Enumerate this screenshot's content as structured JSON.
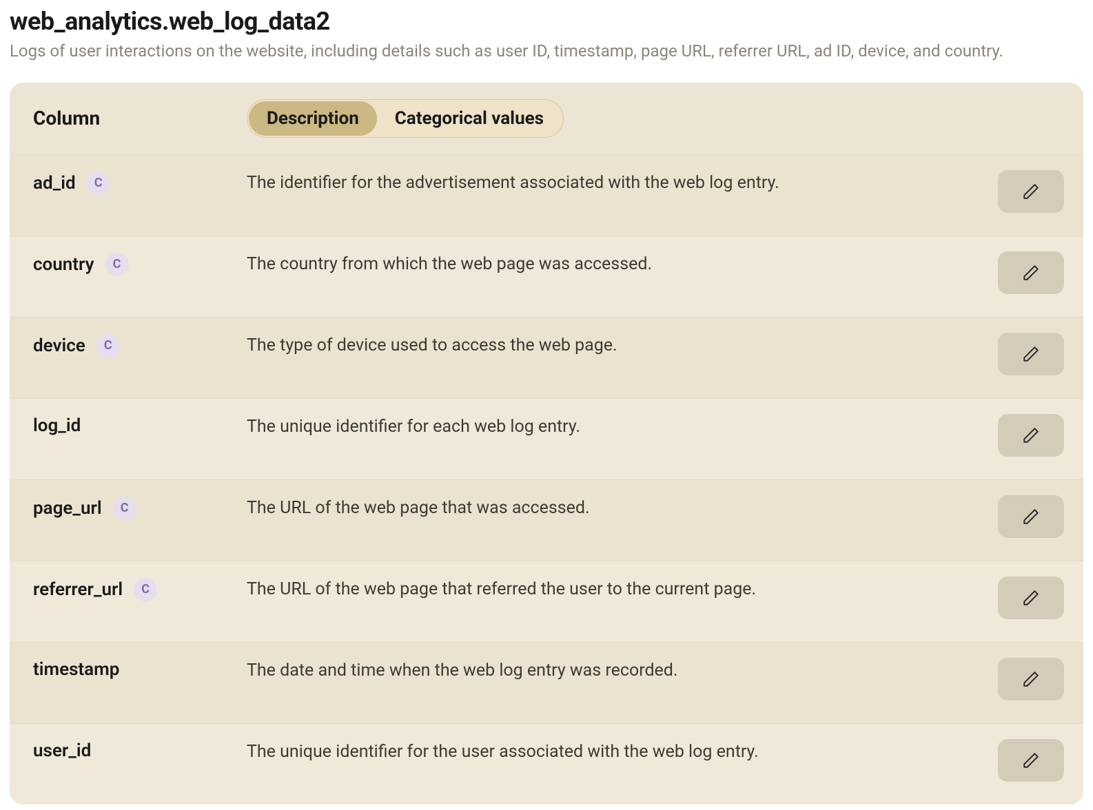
{
  "header": {
    "title": "web_analytics.web_log_data2",
    "subtitle": "Logs of user interactions on the website, including details such as user ID, timestamp, page URL, referrer URL, ad ID, device, and country."
  },
  "columns_header": {
    "column_label": "Column"
  },
  "tabs": {
    "description": "Description",
    "categorical": "Categorical values",
    "active": "description"
  },
  "badge_letter": "C",
  "rows": [
    {
      "name": "ad_id",
      "categorical": true,
      "description": "The identifier for the advertisement associated with the web log entry."
    },
    {
      "name": "country",
      "categorical": true,
      "description": "The country from which the web page was accessed."
    },
    {
      "name": "device",
      "categorical": true,
      "description": "The type of device used to access the web page."
    },
    {
      "name": "log_id",
      "categorical": false,
      "description": "The unique identifier for each web log entry."
    },
    {
      "name": "page_url",
      "categorical": true,
      "description": "The URL of the web page that was accessed."
    },
    {
      "name": "referrer_url",
      "categorical": true,
      "description": "The URL of the web page that referred the user to the current page."
    },
    {
      "name": "timestamp",
      "categorical": false,
      "description": "The date and time when the web log entry was recorded."
    },
    {
      "name": "user_id",
      "categorical": false,
      "description": "The unique identifier for the user associated with the web log entry."
    }
  ]
}
